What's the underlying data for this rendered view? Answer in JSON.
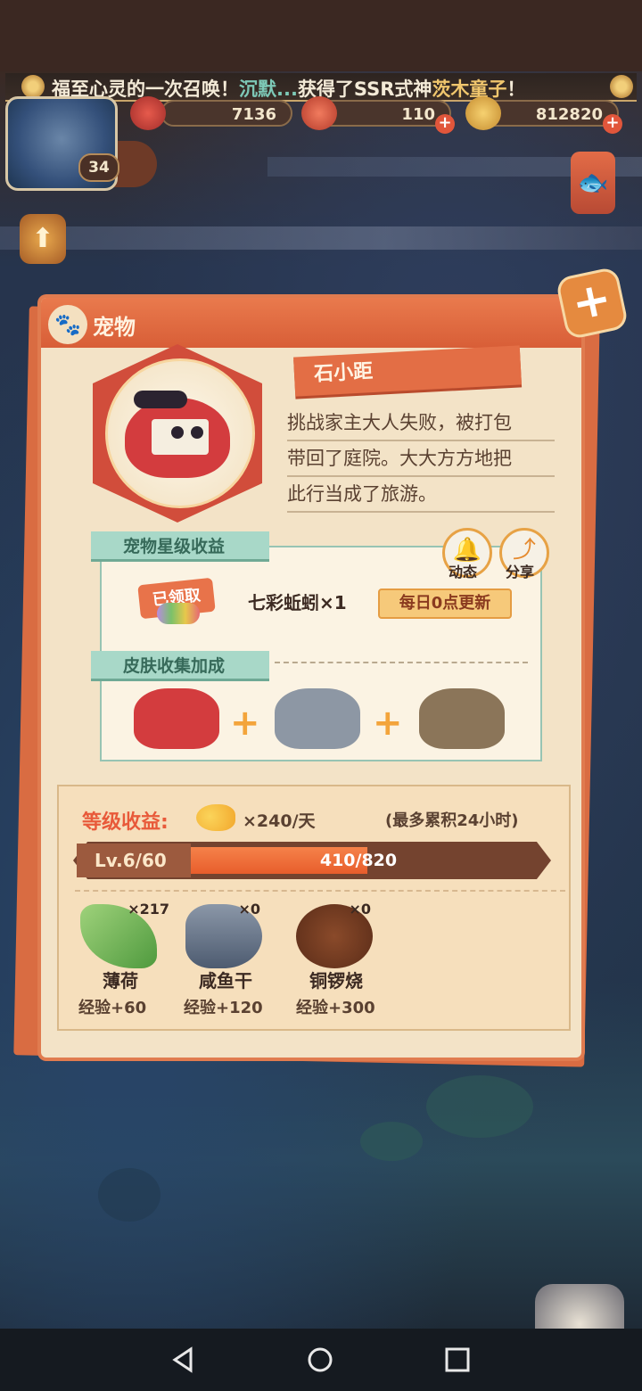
{
  "banner": {
    "prefix": "福至心灵的一次召唤！",
    "player": "沉默...",
    "middle": "获得了SSR式神",
    "shikigami": "茨木童子",
    "suffix": "！"
  },
  "player": {
    "level": "34"
  },
  "resources": [
    {
      "name": "gouyu",
      "value": "7136"
    },
    {
      "name": "stamina",
      "value": "110"
    },
    {
      "name": "gold",
      "value": "812820"
    }
  ],
  "panel": {
    "title": "宠物",
    "pet_name": "石小距",
    "description": [
      "挑战家主大人失败，被打包",
      "带回了庭院。大大方方地把",
      "此行当成了旅游。"
    ],
    "star_income_tag": "宠物星级收益",
    "claimed_label": "已领取",
    "reward_text": "七彩蚯蚓×1",
    "refresh_text": "每日0点更新",
    "activity_label": "动态",
    "share_label": "分享",
    "skin_tag": "皮肤收集加成",
    "level_income_label": "等级收益:",
    "income_rate": "×240/天",
    "income_cap": "(最多累积24小时)",
    "level_text": "Lv.6/60",
    "exp_text": "410/820",
    "exp_fraction": 0.5,
    "foods": [
      {
        "name": "薄荷",
        "count": "×217",
        "exp": "经验+60",
        "icon": "mint-leaf-icon"
      },
      {
        "name": "咸鱼干",
        "count": "×0",
        "exp": "经验+120",
        "icon": "dried-fish-icon"
      },
      {
        "name": "铜锣烧",
        "count": "×0",
        "exp": "经验+300",
        "icon": "dorayaki-icon"
      }
    ]
  },
  "colors": {
    "accent": "#e36e45",
    "teal": "#a8d8c8",
    "bar_fill": "#e85d2c"
  }
}
